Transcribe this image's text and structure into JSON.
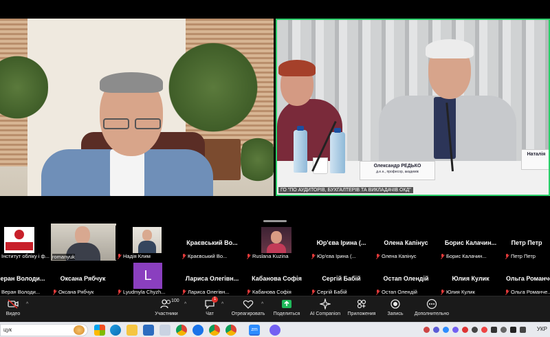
{
  "main_view": {
    "right_video_caption": "ГО \"ПО АУДИТОРІВ, БУХГАЛТЕРІВ ТА ВИКЛАДАЧІВ ОКД\"",
    "nameplate_main": "Олександр РЕДЬКО",
    "nameplate_main_sub": "д.е.н., професор, академік",
    "nameplate_side": "Наталія"
  },
  "gallery": {
    "row1": [
      {
        "big": "",
        "small": "Інститут обліку і ф..."
      },
      {
        "big": "",
        "small": "romanyuk"
      },
      {
        "big": "",
        "small": "Надія Клим"
      },
      {
        "big": "Краєвський Во...",
        "small": "Краєвський Во..."
      },
      {
        "big": "",
        "small": "Ruslana Kuzina"
      },
      {
        "big": "Юр'єва Ірина (...",
        "small": "Юр'єва Ірина (..."
      },
      {
        "big": "Олена Капінус",
        "small": "Олена Капінус"
      },
      {
        "big": "Борис Калачин...",
        "small": "Борис Калачин..."
      },
      {
        "big": "Петр Петр",
        "small": "Петр Петр"
      }
    ],
    "row2": [
      {
        "big": "Веран Володи...",
        "small": "Веран Володи..."
      },
      {
        "big": "Оксана Рябчук",
        "small": "Оксана Рябчук"
      },
      {
        "big": "L",
        "small": "Lyudmyla Chyzh..."
      },
      {
        "big": "Лариса Олегівн...",
        "small": "Лариса Олегівн..."
      },
      {
        "big": "Кабанова Софія",
        "small": "Кабанова Софія"
      },
      {
        "big": "Сергій Бабій",
        "small": "Сергій Бабій"
      },
      {
        "big": "Остап Олендій",
        "small": "Остап Олендій"
      },
      {
        "big": "Юлия Кулик",
        "small": "Юлия Кулик"
      },
      {
        "big": "Ольга Романче...",
        "small": "Ольга Романче..."
      }
    ]
  },
  "toolbar": {
    "video_label": "Видео",
    "participants_label": "Участники",
    "participants_count": "100",
    "chat_label": "Чат",
    "chat_badge": "1",
    "react_label": "Отреагировать",
    "share_label": "Поделиться",
    "ai_label": "AI Companion",
    "apps_label": "Приложения",
    "record_label": "Запись",
    "more_label": "Дополнительно"
  },
  "taskbar": {
    "search_text": "цук",
    "language": "УКР",
    "zoom_icon_text": "zm"
  }
}
